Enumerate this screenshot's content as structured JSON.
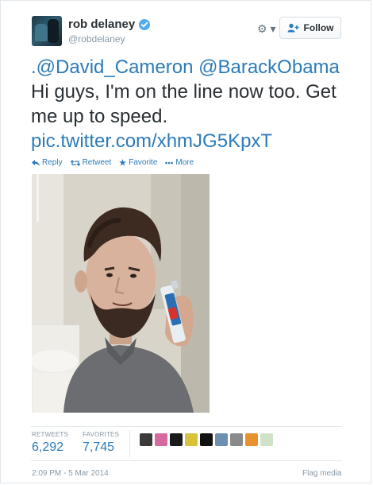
{
  "user": {
    "name": "rob delaney",
    "handle": "@robdelaney"
  },
  "header": {
    "follow_label": "Follow",
    "gear_label": "⚙ ▾"
  },
  "tweet": {
    "mention1": ".@David_Cameron",
    "mention2": "@BarackObama",
    "body": "Hi guys, I'm on the line now too. Get me up to speed.",
    "link": "pic.twitter.com/xhmJG5KpxT"
  },
  "actions": {
    "reply": "Reply",
    "retweet": "Retweet",
    "favorite": "Favorite",
    "more": "More"
  },
  "stats": {
    "retweets_label": "RETWEETS",
    "retweets_value": "6,292",
    "favorites_label": "FAVORITES",
    "favorites_value": "7,745"
  },
  "footer": {
    "date": "2:09 PM - 5 Mar 2014",
    "flag": "Flag media"
  },
  "colors": {
    "link": "#2b7bb9",
    "muted": "#8899a6",
    "text": "#292f33",
    "verified": "#55acee"
  },
  "favoriter_avatar_colors": [
    "#3a3a3a",
    "#d46a9e",
    "#1a1a1a",
    "#d9c23a",
    "#111111",
    "#6d8fb0",
    "#8a8a8a",
    "#e8912d",
    "#cfe3c8"
  ]
}
